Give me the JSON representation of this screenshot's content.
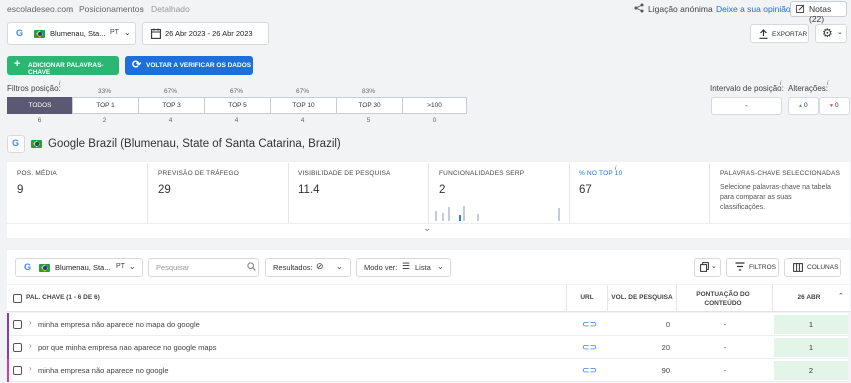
{
  "breadcrumb": [
    "escoladeseo.com",
    "Posicionamentos",
    "Detalhado"
  ],
  "topbar": {
    "share_label": "Ligação anónima",
    "feedback_label": "Deixe a sua opinião",
    "notes_label": "Notas (22)"
  },
  "location": {
    "engine": "G",
    "name": "Blumenau, Sta...",
    "lang": "PT"
  },
  "date_range": "26 Abr 2023 - 26 Abr 2023",
  "export_label": "EXPORTAR",
  "add_keywords_label": "ADICIONAR PALAVRAS-CHAVE",
  "recheck_label": "VOLTAR A VERIFICAR OS DADOS",
  "position_filters": {
    "label": "Filtros posição:",
    "segments": [
      {
        "label": "TODOS",
        "pct": "",
        "count": "6"
      },
      {
        "label": "TOP 1",
        "pct": "33%",
        "count": "2"
      },
      {
        "label": "TOP 3",
        "pct": "67%",
        "count": "4"
      },
      {
        "label": "TOP 5",
        "pct": "67%",
        "count": "4"
      },
      {
        "label": "TOP 10",
        "pct": "67%",
        "count": "4"
      },
      {
        "label": "TOP 30",
        "pct": "83%",
        "count": "5"
      },
      {
        "label": ">100",
        "pct": "",
        "count": "0"
      }
    ]
  },
  "interval": {
    "label": "Intervalo de posição:",
    "value": "-"
  },
  "changes": {
    "label": "Alterações:",
    "up": "0",
    "down": "0"
  },
  "engine_title": "Google Brazil (Blumenau, State of Santa Catarina, Brazil)",
  "metrics": [
    {
      "label": "POS. MÉDIA",
      "value": "9"
    },
    {
      "label": "PREVISÃO DE TRÁFEGO",
      "value": "29"
    },
    {
      "label": "VISIBILIDADE DE PESQUISA",
      "value": "11.4"
    },
    {
      "label": "FUNCIONALIDADES SERP",
      "value": "2"
    },
    {
      "label": "% NO TOP 10",
      "value": "67"
    }
  ],
  "selected_keywords": {
    "label": "PALAVRAS-CHAVE SELECCIONADAS",
    "text": "Selecione palavras-chave na tabela para comparar as suas classificações."
  },
  "toolbar": {
    "search_placeholder": "Pesquisar",
    "results_label": "Resultados:",
    "view_label": "Modo ver:",
    "view_value": "Lista",
    "filters_label": "FILTROS",
    "columns_label": "COLUNAS"
  },
  "table": {
    "headers": {
      "keyword": "PAL. CHAVE (1 - 6 DE 6)",
      "url": "URL",
      "volume": "VOL. DE PESQUISA",
      "score": "PONTUAÇÃO DO CONTEÚDO",
      "date": "26 ABR"
    },
    "rows": [
      {
        "keyword": "minha empresa não aparece no mapa do google",
        "volume": "0",
        "score": "-",
        "pos": "1",
        "accent": "#7b3fc4"
      },
      {
        "keyword": "por que minha empresa nao aparece no google maps",
        "volume": "20",
        "score": "-",
        "pos": "1",
        "accent": "#7b3fc4"
      },
      {
        "keyword": "minha empresa não aparece no google",
        "volume": "90",
        "score": "-",
        "pos": "2",
        "accent": "#d63aa7"
      }
    ]
  }
}
